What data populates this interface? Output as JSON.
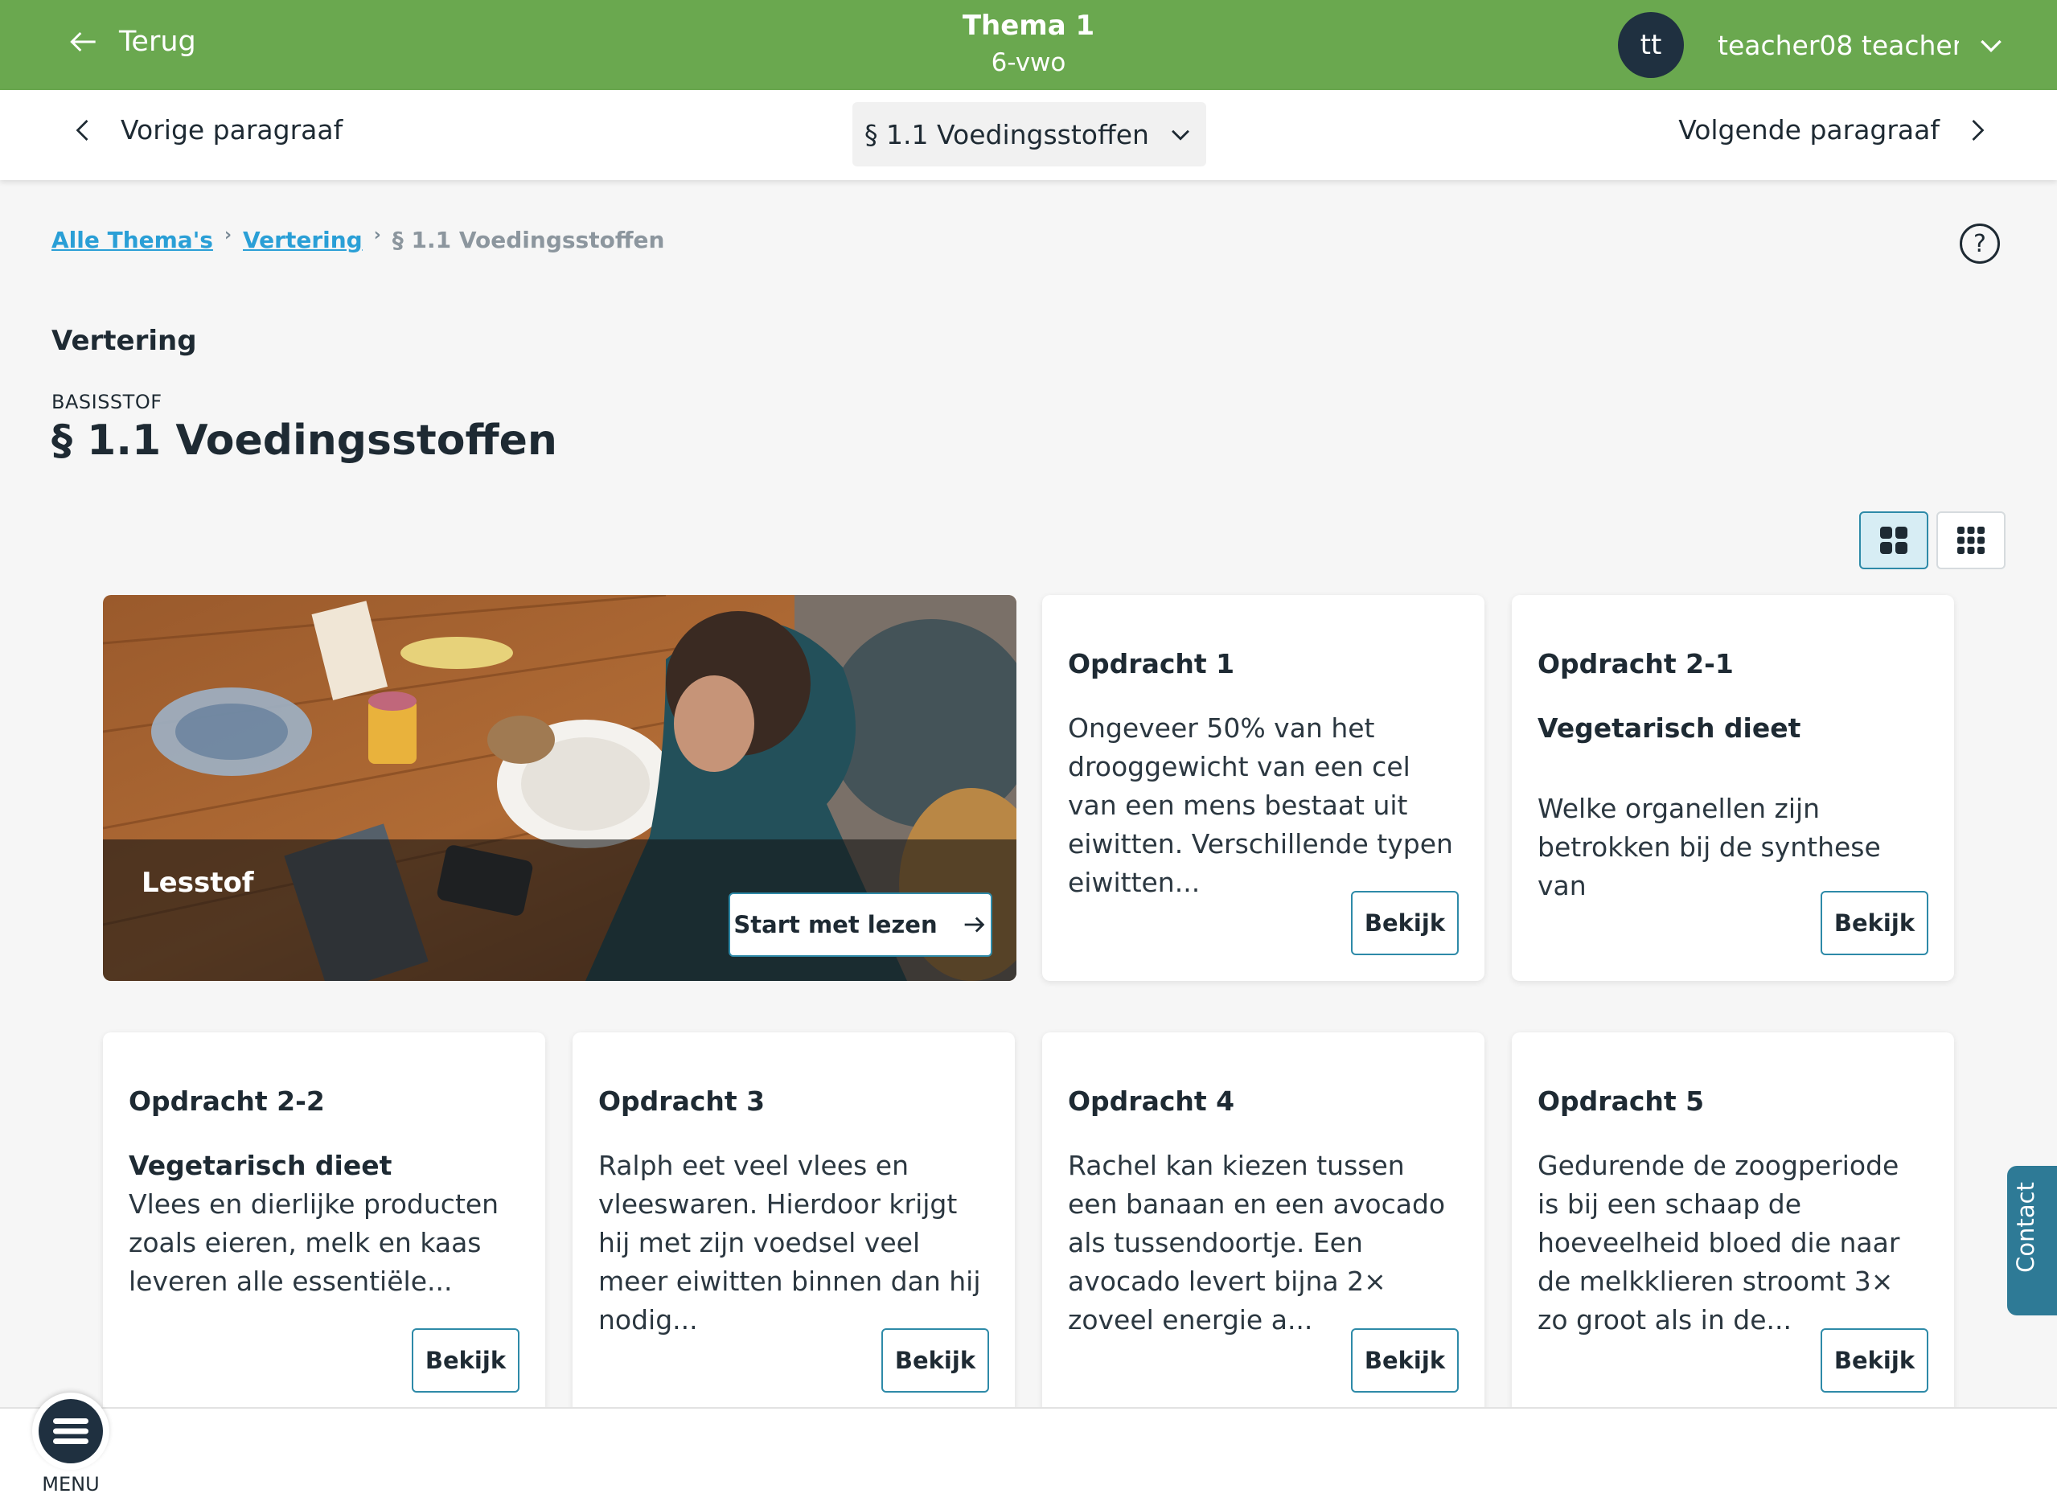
{
  "topbar": {
    "back_label": "Terug",
    "theme_title": "Thema 1",
    "theme_sub": "6-vwo",
    "avatar_initials": "tt",
    "user_name": "teacher08 teacher..."
  },
  "subnav": {
    "prev_label": "Vorige paragraaf",
    "section_label": "§ 1.1 Voedingsstoffen",
    "next_label": "Volgende paragraaf"
  },
  "breadcrumb": {
    "items": [
      "Alle Thema's",
      "Vertering"
    ],
    "current": "§ 1.1 Voedingsstoffen"
  },
  "help_symbol": "?",
  "page": {
    "chapter": "Vertering",
    "kind": "BASISSTOF",
    "title": "§ 1.1 Voedingsstoffen"
  },
  "lesstof": {
    "label": "Lesstof",
    "button": "Start met lezen"
  },
  "cards": [
    {
      "title": "Opdracht 1",
      "subtitle": "",
      "text": "Ongeveer 50% van het drooggewicht van een cel van een mens bestaat uit eiwitten. Verschillende typen eiwitten...",
      "button": "Bekijk"
    },
    {
      "title": "Opdracht 2-1",
      "subtitle": "Vegetarisch dieet",
      "text": "Welke organellen zijn betrokken bij de synthese van",
      "button": "Bekijk"
    },
    {
      "title": "Opdracht 2-2",
      "subtitle": "Vegetarisch dieet",
      "text": "Vlees en dierlijke producten zoals eieren, melk en kaas leveren alle essentiële...",
      "button": "Bekijk"
    },
    {
      "title": "Opdracht 3",
      "subtitle": "",
      "text": "Ralph eet veel vlees en vleeswaren. Hierdoor krijgt hij met zijn voedsel veel meer eiwitten binnen dan hij nodig...",
      "button": "Bekijk"
    },
    {
      "title": "Opdracht 4",
      "subtitle": "",
      "text": "Rachel kan kiezen tussen een banaan en een avocado als tussendoortje. Een avocado levert bijna 2× zoveel energie a...",
      "button": "Bekijk"
    },
    {
      "title": "Opdracht 5",
      "subtitle": "",
      "text": "Gedurende de zoogperiode is bij een schaap de hoeveelheid bloed die naar de melkklieren stroomt 3× zo groot als in de...",
      "button": "Bekijk"
    }
  ],
  "menu_label": "MENU",
  "contact_label": "Contact",
  "colors": {
    "accent": "#6aa84f",
    "button_border": "#2e8aa8",
    "link": "#2a9fd6",
    "dark": "#1f3040"
  }
}
